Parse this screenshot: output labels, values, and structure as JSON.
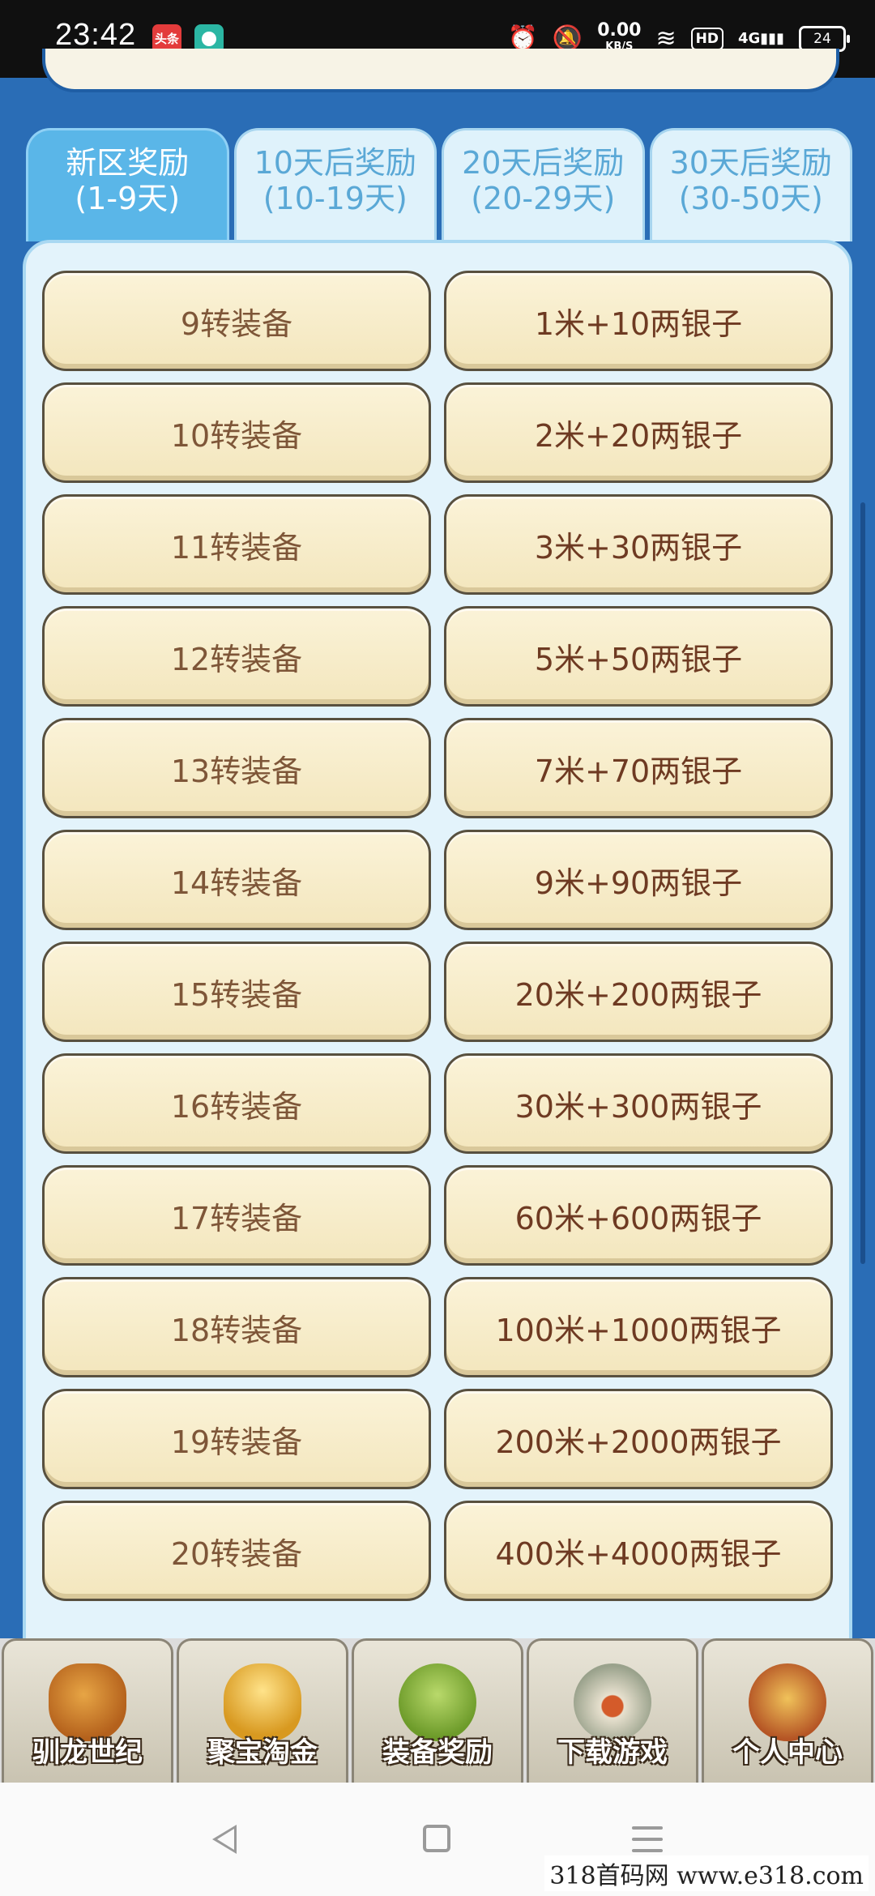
{
  "status_bar": {
    "time": "23:42",
    "app1_label": "头条",
    "net_speed": "0.00",
    "net_unit": "KB/S",
    "hd": "HD",
    "network": "4G",
    "battery": "24"
  },
  "tabs": [
    {
      "line1": "新区奖励",
      "line2": "(1-9天)",
      "active": true
    },
    {
      "line1": "10天后奖励",
      "line2": "(10-19天)",
      "active": false
    },
    {
      "line1": "20天后奖励",
      "line2": "(20-29天)",
      "active": false
    },
    {
      "line1": "30天后奖励",
      "line2": "(30-50天)",
      "active": false
    }
  ],
  "rewards": [
    {
      "condition": "9转装备",
      "reward": "1米+10两银子"
    },
    {
      "condition": "10转装备",
      "reward": "2米+20两银子"
    },
    {
      "condition": "11转装备",
      "reward": "3米+30两银子"
    },
    {
      "condition": "12转装备",
      "reward": "5米+50两银子"
    },
    {
      "condition": "13转装备",
      "reward": "7米+70两银子"
    },
    {
      "condition": "14转装备",
      "reward": "9米+90两银子"
    },
    {
      "condition": "15转装备",
      "reward": "20米+200两银子"
    },
    {
      "condition": "16转装备",
      "reward": "30米+300两银子"
    },
    {
      "condition": "17转装备",
      "reward": "60米+600两银子"
    },
    {
      "condition": "18转装备",
      "reward": "100米+1000两银子"
    },
    {
      "condition": "19转装备",
      "reward": "200米+2000两银子"
    },
    {
      "condition": "20转装备",
      "reward": "400米+4000两银子"
    }
  ],
  "game_nav": [
    {
      "label": "驯龙世纪",
      "icon": "dragon-icon"
    },
    {
      "label": "聚宝淘金",
      "icon": "treasure-pot-icon"
    },
    {
      "label": "装备奖励",
      "icon": "equipment-bag-icon"
    },
    {
      "label": "下载游戏",
      "icon": "cave-icon"
    },
    {
      "label": "个人中心",
      "icon": "hero-avatar-icon"
    }
  ],
  "watermark": "318首码网 www.e318.com"
}
